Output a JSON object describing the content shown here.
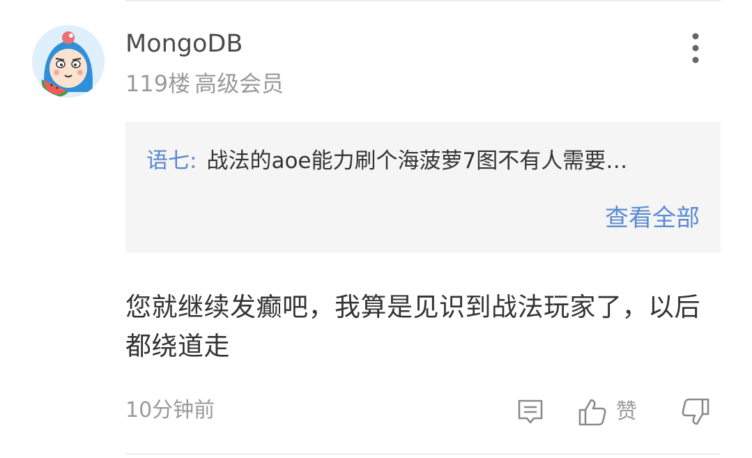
{
  "comment": {
    "username": "MongoDB",
    "floor": "119楼",
    "member_level": "高级会员",
    "reply_preview": {
      "author": "语七",
      "separator": ":",
      "text": "战法的aoe能力刷个海菠萝7图不有人需要…",
      "view_all_label": "查看全部"
    },
    "body": "您就继续发癫吧，我算是见识到战法玩家了，以后都绕道走",
    "timestamp": "10分钟前",
    "actions": {
      "like_label": "赞"
    }
  },
  "icons": {
    "more": "more-vertical-icon",
    "reply": "comment-icon",
    "like": "thumbs-up-icon",
    "dislike": "thumbs-down-icon"
  },
  "colors": {
    "link": "#5a8ad0",
    "muted": "#9a9a9a",
    "text": "#333333",
    "reply_bg": "#f5f5f5",
    "avatar_bg": "#dfeffc"
  }
}
